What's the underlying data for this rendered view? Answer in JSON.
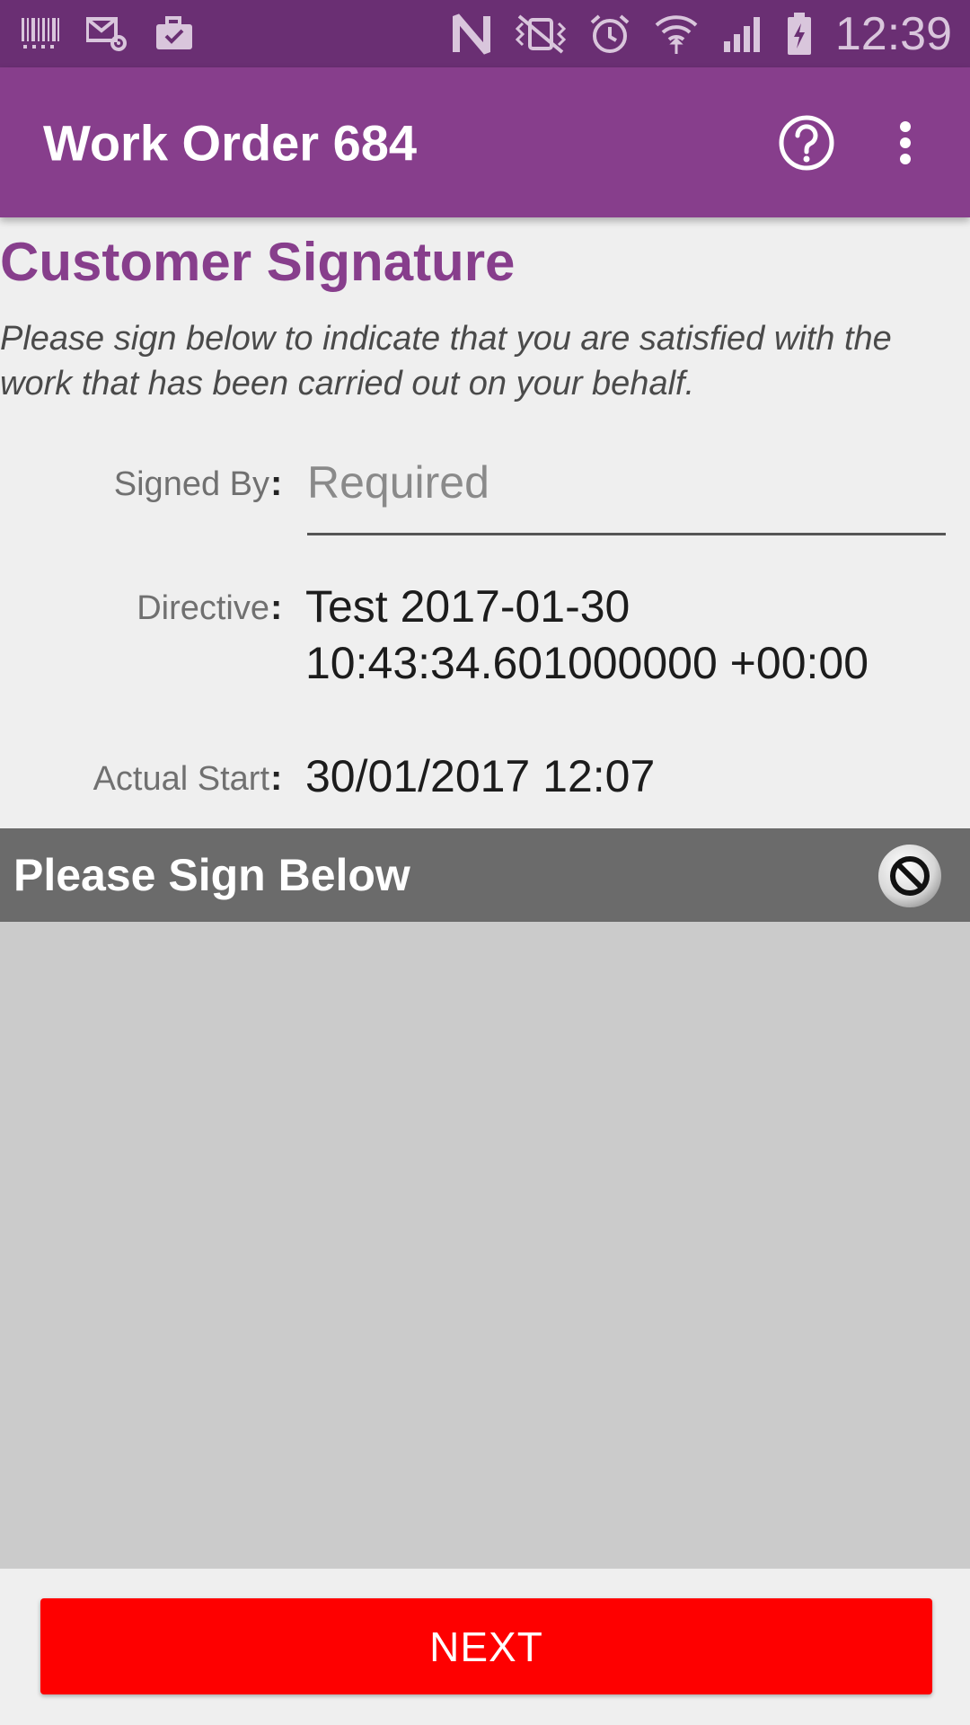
{
  "status_bar": {
    "time": "12:39",
    "icons_left": [
      "barcode-icon",
      "mail-settings-icon",
      "briefcase-check-icon"
    ],
    "icons_right": [
      "nfc-icon",
      "vibrate-icon",
      "alarm-icon",
      "wifi-icon",
      "signal-icon",
      "battery-charging-icon"
    ]
  },
  "app_bar": {
    "title": "Work Order 684",
    "icons": [
      "help-icon",
      "more-vert-icon"
    ]
  },
  "page": {
    "heading": "Customer Signature",
    "intro": "Please sign below to indicate that you are satisfied with the work that has been carried out on your behalf."
  },
  "fields": {
    "signed_by": {
      "label": "Signed By",
      "colon": ":",
      "value": "",
      "placeholder": "Required"
    },
    "directive": {
      "label": "Directive",
      "colon": ":",
      "value_line1": "Test 2017-01-30",
      "value_line2": "10:43:34.601000000 +00:00"
    },
    "actual_start": {
      "label": "Actual Start",
      "colon": ":",
      "value": "30/01/2017 12:07"
    }
  },
  "signature": {
    "title": "Please Sign Below",
    "clear_icon": "clear-signature-icon"
  },
  "footer": {
    "next_label": "NEXT"
  },
  "colors": {
    "status_bar": "#6a2f73",
    "app_bar": "#873e8c",
    "heading": "#873e8c",
    "sign_header": "#6b6b6b",
    "sign_pad": "#cbcbcb",
    "next_button": "#fe0000"
  }
}
